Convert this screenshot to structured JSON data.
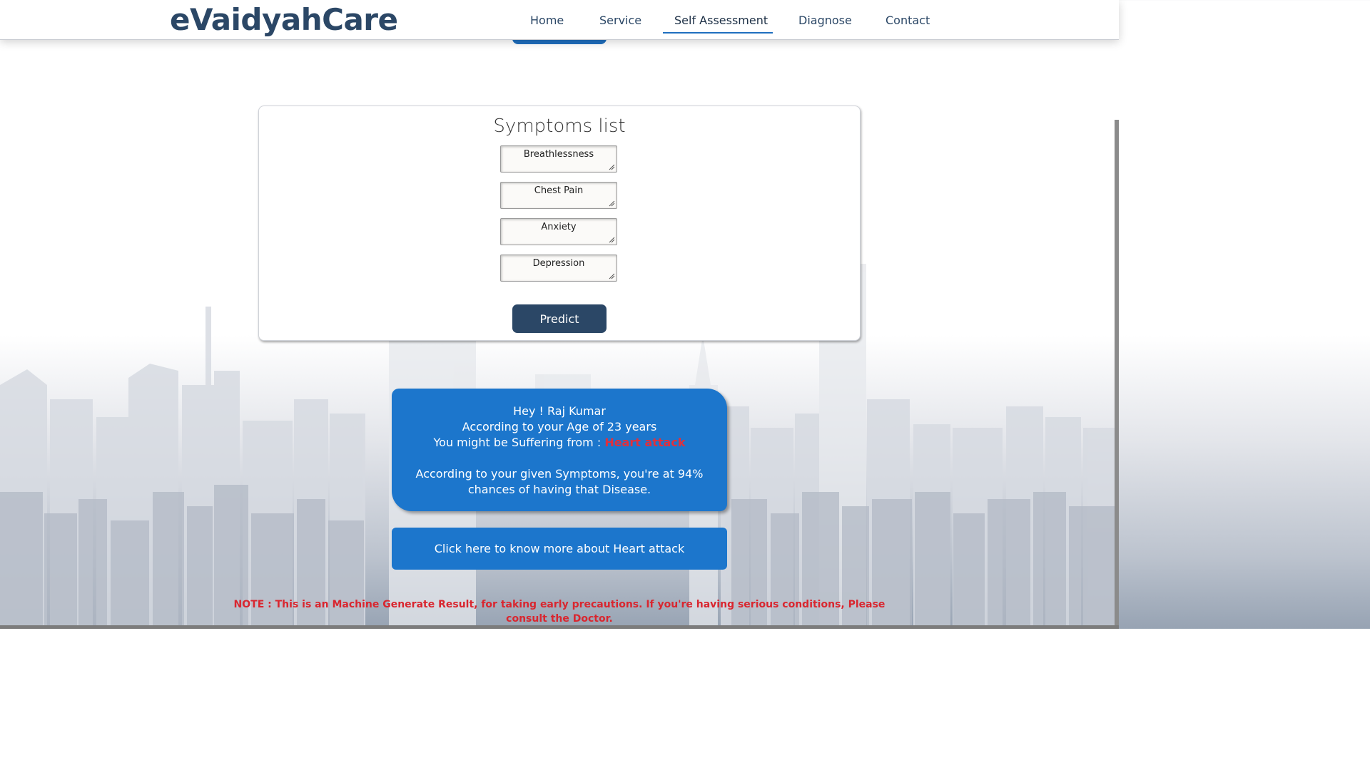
{
  "header": {
    "logo": "eVaidyahCare",
    "nav": [
      {
        "label": "Home"
      },
      {
        "label": "Service"
      },
      {
        "label": "Self Assessment"
      },
      {
        "label": "Diagnose"
      },
      {
        "label": "Contact"
      }
    ],
    "active_nav": "Self Assessment"
  },
  "symptoms_card": {
    "title": "Symptoms list",
    "symptoms": [
      "Breathlessness",
      "Chest Pain",
      "Anxiety",
      "Depression"
    ],
    "predict_label": "Predict"
  },
  "result": {
    "greeting": "Hey ! Raj Kumar",
    "age_line": "According to your Age of 23 years",
    "suffering_prefix": "You might be Suffering from :",
    "disease": "Heart attack",
    "chance_line_1": "According to your given Symptoms, you're at 94%",
    "chance_line_2": "chances of having that Disease."
  },
  "more_button": {
    "label": "Click here to know more about Heart attack"
  },
  "note": "NOTE : This is an Machine Generate Result, for taking early precautions. If you're having serious conditions, Please consult the Doctor.",
  "colors": {
    "brand_navy": "#2b4766",
    "accent_blue": "#1c76cc",
    "warning_red": "#d9262f"
  }
}
